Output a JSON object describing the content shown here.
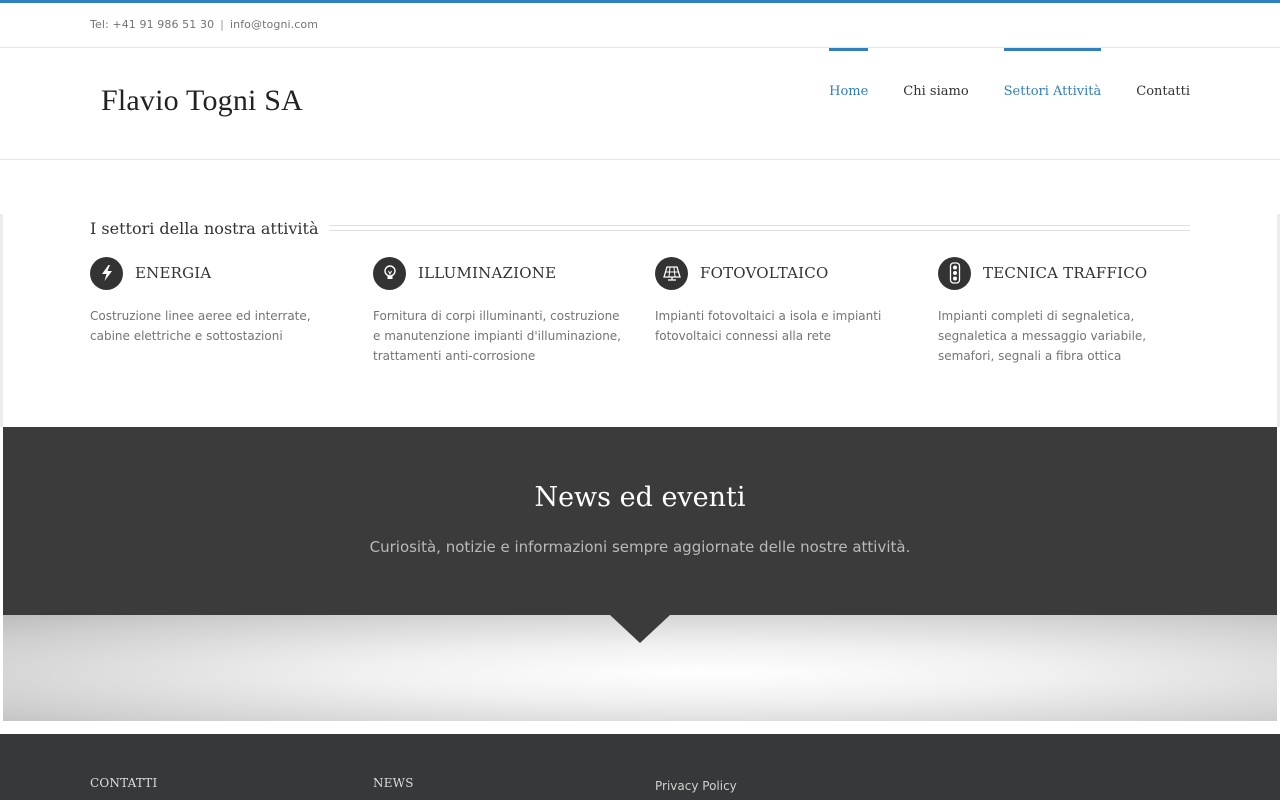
{
  "topbar": {
    "phone": "Tel: +41 91 986 51 30",
    "separator": "|",
    "email": "info@togni.com"
  },
  "header": {
    "logo": "Flavio Togni SA",
    "nav": [
      {
        "label": "Home",
        "active": true
      },
      {
        "label": "Chi siamo",
        "active": false
      },
      {
        "label": "Settori Attività",
        "active": true
      },
      {
        "label": "Contatti",
        "active": false
      }
    ]
  },
  "sectors": {
    "title": "I settori della nostra attività",
    "items": [
      {
        "title": "ENERGIA",
        "icon": "lightning-icon",
        "desc": "Costruzione linee aeree ed interrate, cabine elettriche e sottostazioni"
      },
      {
        "title": "ILLUMINAZIONE",
        "icon": "lightbulb-icon",
        "desc": "Fornitura di corpi illuminanti, costruzione e manutenzione impianti d'illuminazione, trattamenti anti-corrosione"
      },
      {
        "title": "FOTOVOLTAICO",
        "icon": "solar-panel-icon",
        "desc": "Impianti fotovoltaici a isola e impianti fotovoltaici connessi alla rete"
      },
      {
        "title": "TECNICA TRAFFICO",
        "icon": "traffic-light-icon",
        "desc": "Impianti completi di segnaletica, segnaletica a messaggio variabile, semafori, segnali a fibra ottica"
      }
    ]
  },
  "news": {
    "title": "News ed eventi",
    "subtitle": "Curiosità, notizie e informazioni sempre aggiornate delle nostre attività."
  },
  "footer": {
    "col1": "CONTATTI",
    "col2": "NEWS",
    "link": "Privacy Policy"
  },
  "colors": {
    "accent": "#2f7fc1",
    "dark_band": "#3b3b3c",
    "footer": "#363839"
  }
}
